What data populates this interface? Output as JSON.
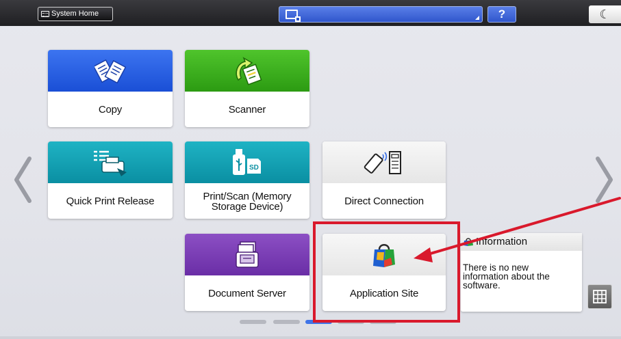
{
  "top_bar": {
    "home_label": "System Home",
    "help_label": "?",
    "energy_icon": "moon-icon"
  },
  "tiles": [
    {
      "label": "Copy",
      "color": "#2457e0",
      "icon": "copy-icon"
    },
    {
      "label": "Scanner",
      "color": "#36a91b",
      "icon": "scanner-icon"
    },
    {
      "label": "Quick Print Release",
      "color": "#0fa0b3",
      "icon": "printer-icon"
    },
    {
      "label": "Print/Scan (Memory Storage Device)",
      "color": "#0fa0b3",
      "icon": "usb-sd-icon"
    },
    {
      "label": "Direct Connection",
      "color": "#f0f0f0",
      "icon": "phone-connection-icon"
    },
    {
      "label": "Document Server",
      "color": "#7a3cb5",
      "icon": "document-server-icon"
    },
    {
      "label": "Application Site",
      "color": "#f0f0f0",
      "icon": "shopping-bag-icon"
    }
  ],
  "info_widget": {
    "title": "Information",
    "message": "There is no new information about the software."
  },
  "pagination": {
    "pages": 5,
    "active": 3
  },
  "annotation_color": "#d9192c"
}
